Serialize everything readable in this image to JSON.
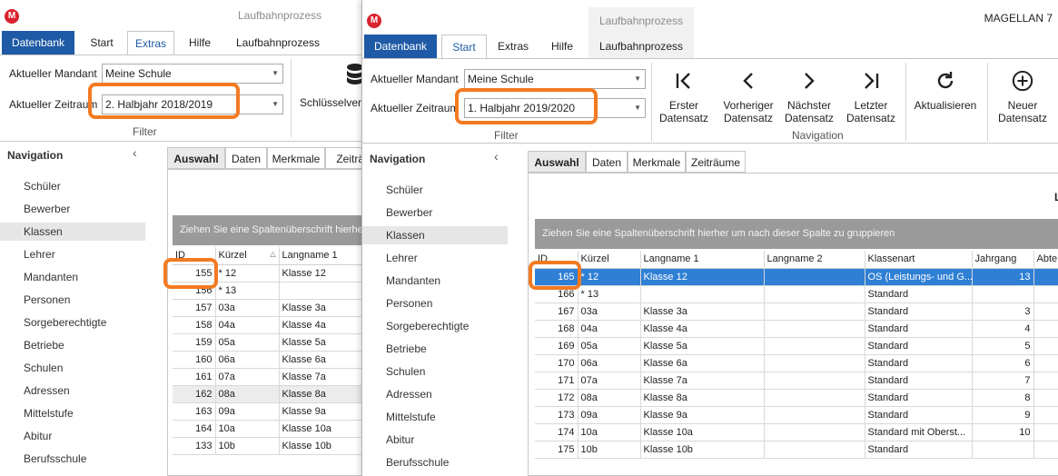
{
  "back": {
    "window_title": "Laufbahnprozess",
    "logo": "M",
    "ribbon_tabs": [
      "Datenbank",
      "Start",
      "Extras",
      "Hilfe",
      "Laufbahnprozess"
    ],
    "mandant_label": "Aktueller Mandant",
    "mandant_value": "Meine Schule",
    "zeitraum_label": "Aktueller Zeitraum",
    "zeitraum_value": "2. Halbjahr 2018/2019",
    "filter_label": "Filter",
    "schluessel_label": "Schlüsselverz",
    "nav_title": "Navigation",
    "nav_items": [
      "Schüler",
      "Bewerber",
      "Klassen",
      "Lehrer",
      "Mandanten",
      "Personen",
      "Sorgeberechtigte",
      "Betriebe",
      "Schulen",
      "Adressen",
      "Mittelstufe",
      "Abitur",
      "Berufsschule"
    ],
    "sub_tabs": [
      "Auswahl",
      "Daten",
      "Merkmale",
      "Zeiträu"
    ],
    "group_hint": "Ziehen Sie eine Spaltenüberschrift hierher",
    "columns": [
      "ID",
      "Kürzel",
      "Langname 1"
    ],
    "rows": [
      [
        "155",
        "* 12",
        "Klasse 12"
      ],
      [
        "156",
        "* 13",
        ""
      ],
      [
        "157",
        "03a",
        "Klasse 3a"
      ],
      [
        "158",
        "04a",
        "Klasse 4a"
      ],
      [
        "159",
        "05a",
        "Klasse 5a"
      ],
      [
        "160",
        "06a",
        "Klasse 6a"
      ],
      [
        "161",
        "07a",
        "Klasse 7a"
      ],
      [
        "162",
        "08a",
        "Klasse 8a"
      ],
      [
        "163",
        "09a",
        "Klasse 9a"
      ],
      [
        "164",
        "10a",
        "Klasse 10a"
      ],
      [
        "133",
        "10b",
        "Klasse 10b"
      ]
    ],
    "selected_row": 7
  },
  "front": {
    "window_title": "Laufbahnprozess",
    "app_title": "MAGELLAN 7",
    "logo": "M",
    "ribbon_tabs": [
      "Datenbank",
      "Start",
      "Extras",
      "Hilfe",
      "Laufbahnprozess"
    ],
    "mandant_label": "Aktueller Mandant",
    "mandant_value": "Meine Schule",
    "zeitraum_label": "Aktueller Zeitraum",
    "zeitraum_value": "1. Halbjahr 2019/2020",
    "filter_label": "Filter",
    "navigation_group_label": "Navigation",
    "buttons": [
      {
        "line1": "Erster",
        "line2": "Datensatz",
        "icon": "first-record-icon"
      },
      {
        "line1": "Vorheriger",
        "line2": "Datensatz",
        "icon": "previous-record-icon"
      },
      {
        "line1": "Nächster",
        "line2": "Datensatz",
        "icon": "next-record-icon"
      },
      {
        "line1": "Letzter",
        "line2": "Datensatz",
        "icon": "last-record-icon"
      },
      {
        "line1": "Aktualisieren",
        "line2": "",
        "icon": "refresh-icon"
      },
      {
        "line1": "Neuer",
        "line2": "Datensatz",
        "icon": "add-record-icon"
      }
    ],
    "nav_title": "Navigation",
    "nav_items": [
      "Schüler",
      "Bewerber",
      "Klassen",
      "Lehrer",
      "Mandanten",
      "Personen",
      "Sorgeberechtigte",
      "Betriebe",
      "Schulen",
      "Adressen",
      "Mittelstufe",
      "Abitur",
      "Berufsschule"
    ],
    "sub_tabs": [
      "Auswahl",
      "Daten",
      "Merkmale",
      "Zeiträume"
    ],
    "right_label": "L",
    "group_hint": "Ziehen Sie eine Spaltenüberschrift hierher um nach dieser Spalte zu gruppieren",
    "columns": [
      "ID",
      "Kürzel",
      "Langname 1",
      "Langname 2",
      "Klassenart",
      "Jahrgang",
      "Abte"
    ],
    "rows": [
      [
        "165",
        "* 12",
        "Klasse 12",
        "",
        "OS (Leistungs- und G...",
        "13"
      ],
      [
        "166",
        "* 13",
        "",
        "",
        "Standard",
        ""
      ],
      [
        "167",
        "03a",
        "Klasse 3a",
        "",
        "Standard",
        "3"
      ],
      [
        "168",
        "04a",
        "Klasse 4a",
        "",
        "Standard",
        "4"
      ],
      [
        "169",
        "05a",
        "Klasse 5a",
        "",
        "Standard",
        "5"
      ],
      [
        "170",
        "06a",
        "Klasse 6a",
        "",
        "Standard",
        "6"
      ],
      [
        "171",
        "07a",
        "Klasse 7a",
        "",
        "Standard",
        "7"
      ],
      [
        "172",
        "08a",
        "Klasse 8a",
        "",
        "Standard",
        "8"
      ],
      [
        "173",
        "09a",
        "Klasse 9a",
        "",
        "Standard",
        "9"
      ],
      [
        "174",
        "10a",
        "Klasse 10a",
        "",
        "Standard mit Oberst...",
        "10"
      ],
      [
        "175",
        "10b",
        "Klasse 10b",
        "",
        "Standard",
        ""
      ]
    ],
    "selected_row": 0
  },
  "colors": {
    "accent_blue": "#1f5aa6",
    "selection_blue": "#2f7fd5",
    "highlight_orange": "#f27a21",
    "logo_red": "#d9232e"
  }
}
